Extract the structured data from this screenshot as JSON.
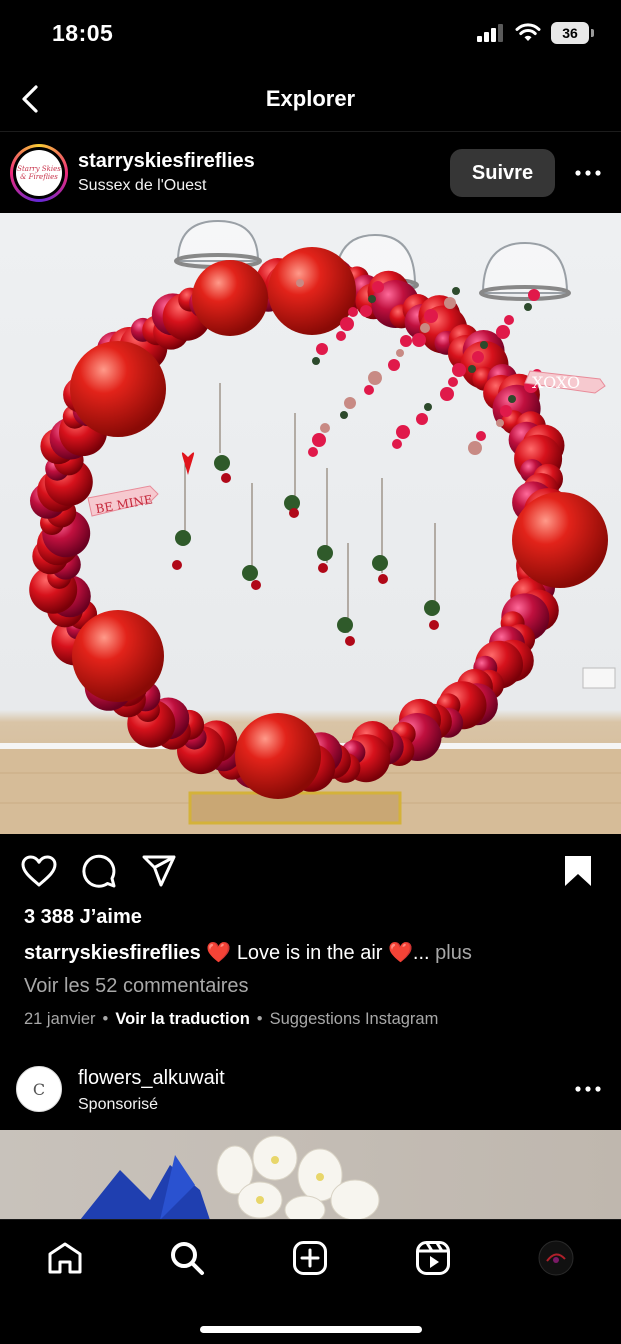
{
  "status_bar": {
    "time": "18:05",
    "battery": "36"
  },
  "header": {
    "title": "Explorer"
  },
  "post": {
    "username": "starryskiesfireflies",
    "location": "Sussex de l'Ouest",
    "follow_label": "Suivre",
    "avatar_text_line1": "Starry Skies",
    "avatar_text_line2": "& Fireflies",
    "photo_sign_left": "BE MINE",
    "photo_sign_right": "XOXO",
    "likes": "3 388 J’aime",
    "caption_user": "starryskiesfireflies",
    "caption_text": " ❤️ Love is in the air ❤️...",
    "caption_more": " plus",
    "comments_link": "Voir les 52 commentaires",
    "date": "21 janvier",
    "translate_label": "Voir la traduction",
    "suggestion_label": "Suggestions Instagram"
  },
  "sponsored": {
    "username": "flowers_alkuwait",
    "label": "Sponsorisé",
    "avatar_letter": "C"
  },
  "colors": {
    "follow_bg": "#363636",
    "muted_text": "#a8a8a8",
    "balloon_red": "#d0101c"
  },
  "icons": [
    "back-icon",
    "more-icon",
    "heart-icon",
    "comment-icon",
    "share-icon",
    "bookmark-icon",
    "home-icon",
    "search-icon",
    "create-icon",
    "reels-icon",
    "profile-icon"
  ]
}
